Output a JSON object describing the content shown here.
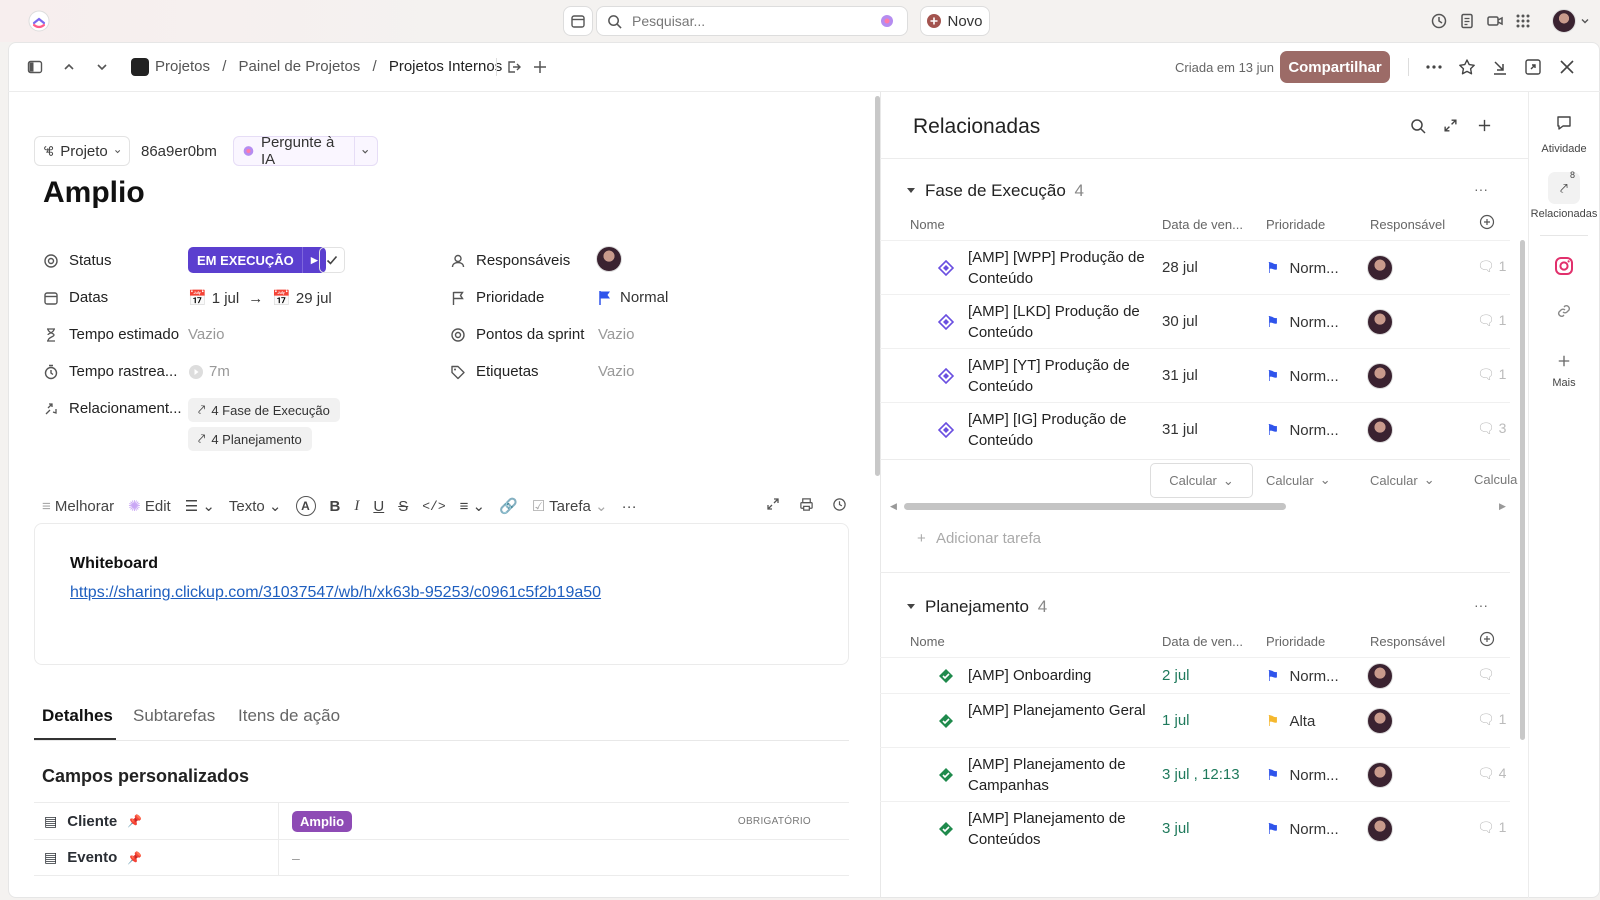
{
  "topbar": {
    "search_placeholder": "Pesquisar...",
    "new_label": "Novo"
  },
  "breadcrumb": {
    "items": [
      "Projetos",
      "Painel de Projetos",
      "Projetos Internos"
    ],
    "separator": "/"
  },
  "header": {
    "created": "Criada em 13 jun",
    "share_label": "Compartilhar"
  },
  "task": {
    "type_label": "Projeto",
    "id": "86a9er0bm",
    "ai_label": "Pergunte à IA",
    "title": "Amplio",
    "fields": {
      "status_label": "Status",
      "status_value": "EM EXECUÇÃO",
      "dates_label": "Datas",
      "start": "1 jul",
      "end": "29 jul",
      "estimate_label": "Tempo estimado",
      "estimate_value": "Vazio",
      "tracked_label": "Tempo rastrea...",
      "tracked_value": "7m",
      "relations_label": "Relacionament...",
      "relation_1": "4 Fase de Execução",
      "relation_2": "4 Planejamento",
      "assignees_label": "Responsáveis",
      "priority_label": "Prioridade",
      "priority_value": "Normal",
      "sprint_label": "Pontos da sprint",
      "sprint_value": "Vazio",
      "tags_label": "Etiquetas",
      "tags_value": "Vazio"
    }
  },
  "editor_toolbar": {
    "improve": "Melhorar",
    "edit": "Edit",
    "text": "Texto",
    "task": "Tarefa"
  },
  "editor": {
    "heading": "Whiteboard",
    "link": "https://sharing.clickup.com/31037547/wb/h/xk63b-95253/c0961c5f2b19a50"
  },
  "tabs": [
    "Detalhes",
    "Subtarefas",
    "Itens de ação"
  ],
  "custom_fields": {
    "title": "Campos personalizados",
    "rows": [
      {
        "label": "Cliente",
        "value": "Amplio",
        "required": "OBRIGATÓRIO"
      },
      {
        "label": "Evento",
        "value": "–"
      }
    ]
  },
  "related": {
    "title": "Relacionadas",
    "columns": [
      "Nome",
      "Data de ven...",
      "Prioridade",
      "Responsável"
    ],
    "calc_label": "Calcular",
    "add_task": "Adicionar tarefa",
    "groups": [
      {
        "name": "Fase de Execução",
        "count": "4",
        "tasks": [
          {
            "name": "[AMP] [WPP] Produção de Conteúdo",
            "date": "28 jul",
            "priority": "Norm...",
            "comments": "1"
          },
          {
            "name": "[AMP] [LKD] Produção de Conteúdo",
            "date": "30 jul",
            "priority": "Norm...",
            "comments": "1"
          },
          {
            "name": "[AMP] [YT] Produção de Conteúdo",
            "date": "31 jul",
            "priority": "Norm...",
            "comments": "1"
          },
          {
            "name": "[AMP] [IG] Produção de Conteúdo",
            "date": "31 jul",
            "priority": "Norm...",
            "comments": "3"
          }
        ]
      },
      {
        "name": "Planejamento",
        "count": "4",
        "tasks": [
          {
            "name": "[AMP] Onboarding",
            "date": "2 jul",
            "priority": "Norm...",
            "comments": ""
          },
          {
            "name": "[AMP] Planejamento Geral",
            "date": "1 jul",
            "priority": "Alta",
            "comments": "1"
          },
          {
            "name": "[AMP] Planejamento de Campanhas",
            "date": "3 jul , 12:13",
            "priority": "Norm...",
            "comments": "4"
          },
          {
            "name": "[AMP] Planejamento de Conteúdos",
            "date": "3 jul",
            "priority": "Norm...",
            "comments": "1"
          }
        ]
      }
    ]
  },
  "right_sidebar": {
    "activity": "Atividade",
    "related": "Relacionadas",
    "related_badge": "8",
    "more": "Mais"
  },
  "colors": {
    "status": "#5b3fcf",
    "share": "#9c6b67",
    "flag_normal": "#2f54eb",
    "flag_high": "#f5b82e",
    "done": "#1f8a4c",
    "task_icon": "#6a4fe0"
  }
}
